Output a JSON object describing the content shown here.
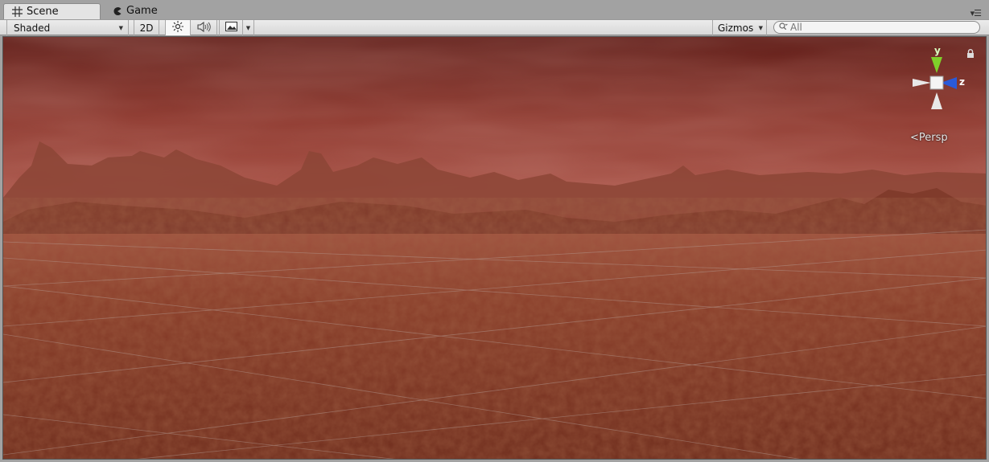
{
  "tabs": [
    {
      "label": "Scene",
      "icon": "grid-icon",
      "active": true
    },
    {
      "label": "Game",
      "icon": "pacman-icon",
      "active": false
    }
  ],
  "toolbar": {
    "draw_mode": "Shaded",
    "mode_2d_label": "2D",
    "gizmos_label": "Gizmos",
    "search_placeholder": "All"
  },
  "scene": {
    "gizmo_axes": {
      "y": "y",
      "z": "z"
    },
    "projection_label": "Persp",
    "colors": {
      "sky": "#7a2a22",
      "ground": "#8a3a25",
      "y_axis": "#7fd02a",
      "z_axis": "#2a5ad8"
    }
  }
}
